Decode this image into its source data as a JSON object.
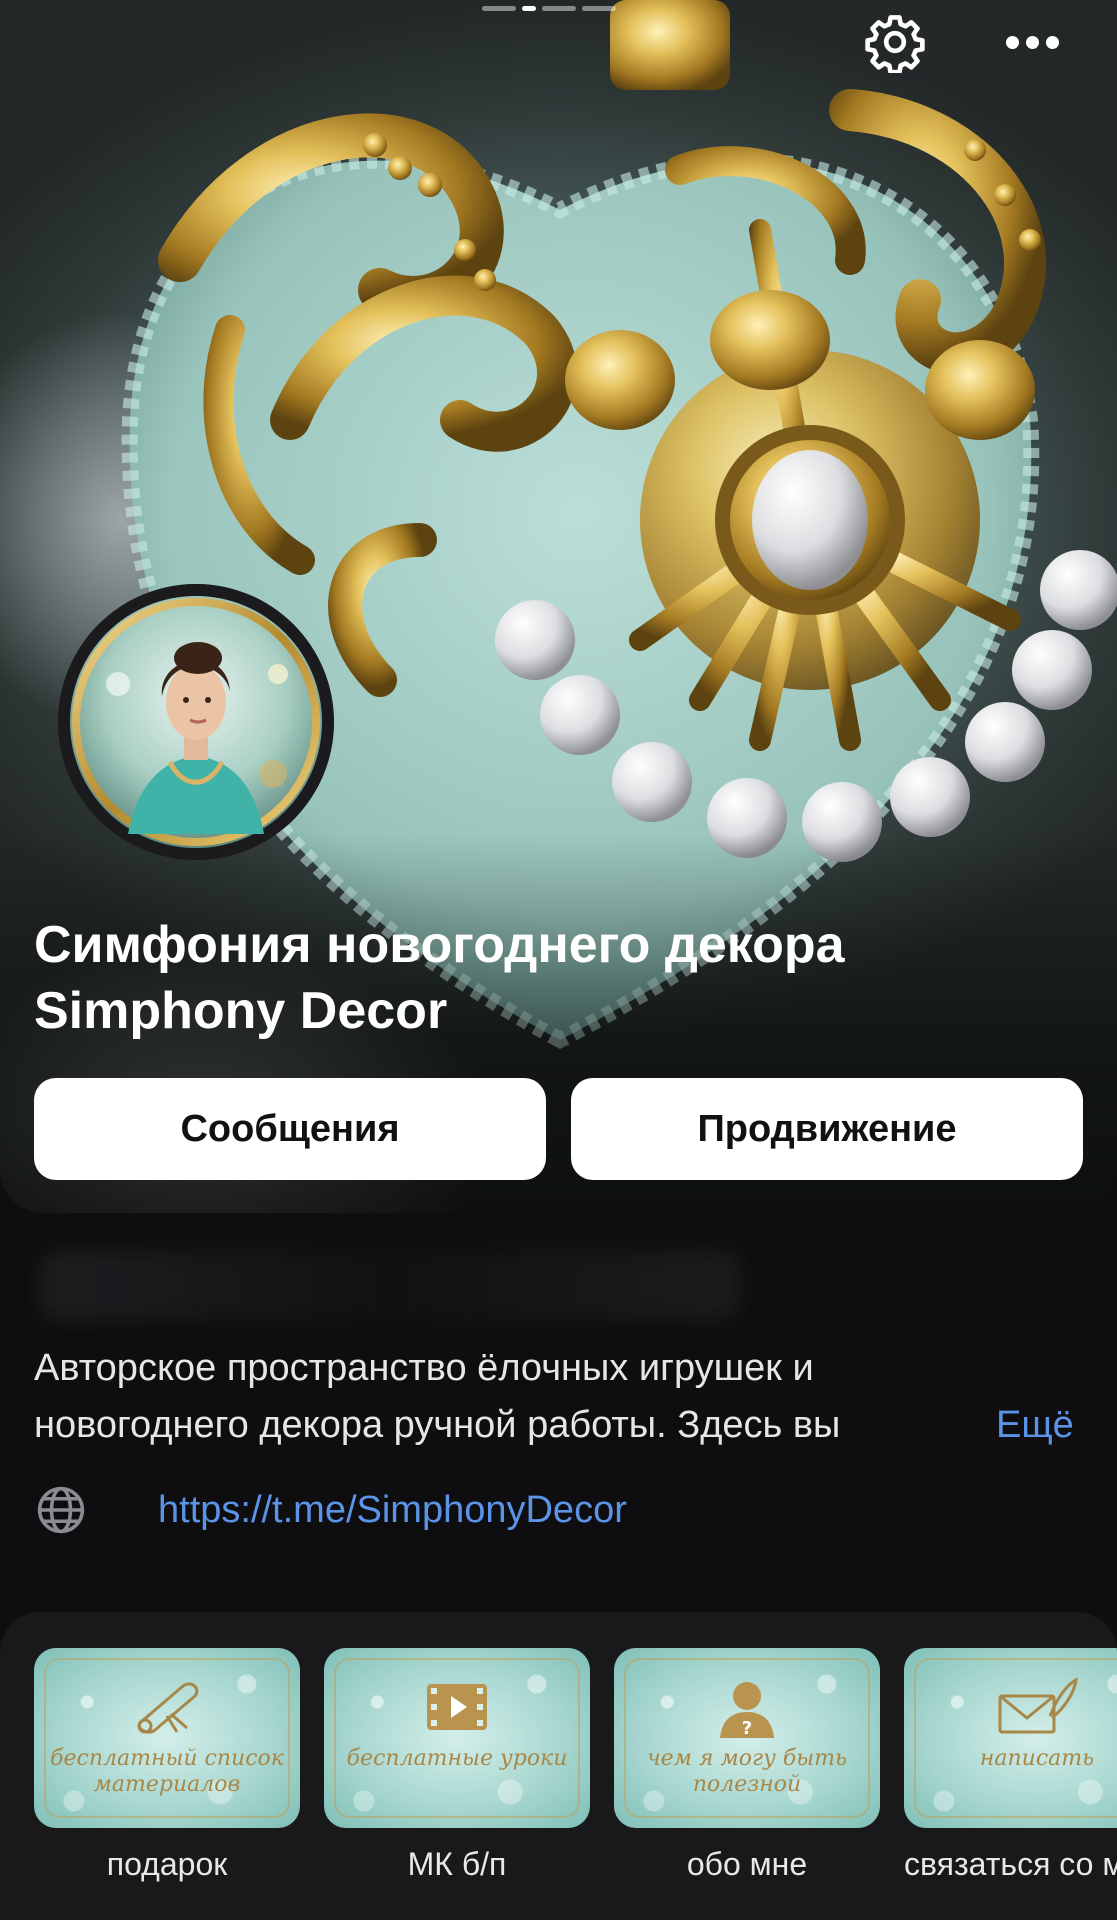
{
  "header": {
    "settings_icon": "gear-icon",
    "more_icon": "more-horizontal-icon"
  },
  "profile": {
    "title": "Симфония новогоднего декора Simphony Decor",
    "buttons": {
      "messages": "Сообщения",
      "promotion": "Продвижение"
    }
  },
  "info": {
    "description_line1": "Авторское пространство ёлочных игрушек и",
    "description_line2": "новогоднего декора ручной работы. Здесь вы",
    "more_label": "Ещё",
    "link_icon": "globe-icon",
    "link": "https://t.me/SimphonyDecor"
  },
  "highlights": [
    {
      "caption": "бесплатный список материалов",
      "label": "подарок",
      "icon": "scroll-icon"
    },
    {
      "caption": "бесплатные уроки",
      "label": "МК б/п",
      "icon": "film-play-icon"
    },
    {
      "caption": "чем я могу быть полезной",
      "label": "обо мне",
      "icon": "user-question-icon"
    },
    {
      "caption": "написать",
      "label": "связаться со мной",
      "icon": "envelope-quill-icon"
    }
  ],
  "colors": {
    "background": "#0e0e10",
    "link": "#5b93e6",
    "button_bg": "#ffffff",
    "gold": "#c9a24a"
  }
}
